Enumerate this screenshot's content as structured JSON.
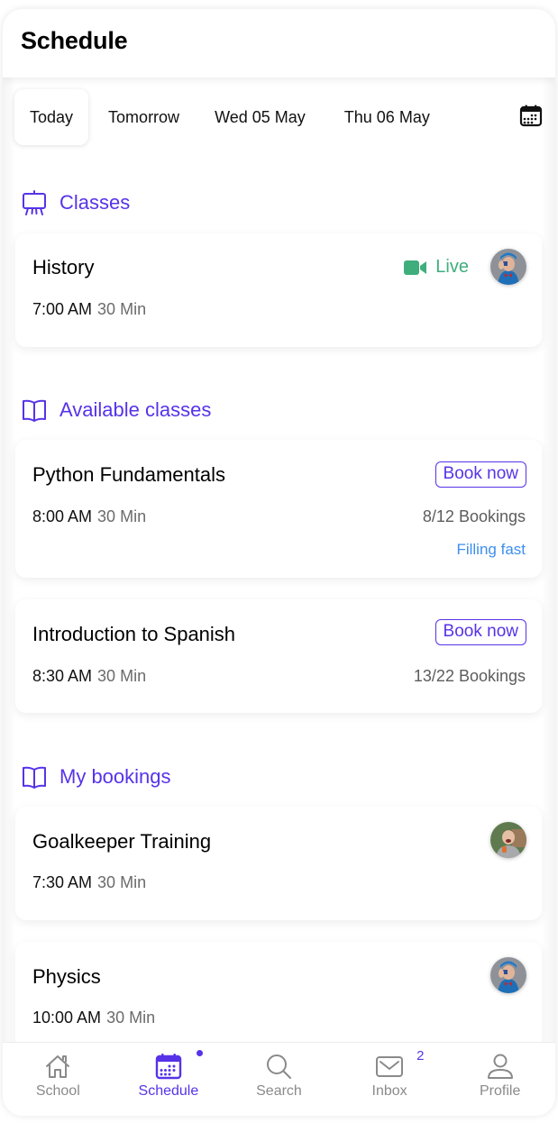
{
  "header": {
    "title": "Schedule"
  },
  "date_tabs": [
    {
      "label": "Today",
      "active": true
    },
    {
      "label": "Tomorrow",
      "active": false
    },
    {
      "label": "Wed 05 May",
      "active": false
    },
    {
      "label": "Thu 06 May",
      "active": false
    }
  ],
  "calendar_button_icon": "calendar-icon",
  "sections": {
    "classes": {
      "title": "Classes",
      "icon": "easel-icon",
      "items": [
        {
          "title": "History",
          "time": "7:00 AM",
          "duration": "30 Min",
          "status": "Live",
          "status_icon": "video-camera-icon",
          "avatar": "teacher-avatar-blue"
        }
      ]
    },
    "available": {
      "title": "Available classes",
      "icon": "book-open-icon",
      "items": [
        {
          "title": "Python Fundamentals",
          "time": "8:00 AM",
          "duration": "30 Min",
          "button": "Book now",
          "bookings": "8/12 Bookings",
          "note": "Filling fast"
        },
        {
          "title": "Introduction to Spanish",
          "time": "8:30 AM",
          "duration": "30 Min",
          "button": "Book now",
          "bookings": "13/22 Bookings"
        }
      ]
    },
    "my_bookings": {
      "title": "My bookings",
      "icon": "book-open-icon",
      "items": [
        {
          "title": "Goalkeeper Training",
          "time": "7:30 AM",
          "duration": "30 Min",
          "avatar": "coach-avatar-child"
        },
        {
          "title": "Physics",
          "time": "10:00 AM",
          "duration": "30 Min",
          "avatar": "teacher-avatar-blue"
        }
      ]
    }
  },
  "tabbar": [
    {
      "label": "School",
      "icon": "home-icon",
      "active": false
    },
    {
      "label": "Schedule",
      "icon": "calendar-icon",
      "active": true,
      "indicator": "dot"
    },
    {
      "label": "Search",
      "icon": "search-icon",
      "active": false
    },
    {
      "label": "Inbox",
      "icon": "mail-icon",
      "active": false,
      "badge": "2"
    },
    {
      "label": "Profile",
      "icon": "user-icon",
      "active": false
    }
  ],
  "colors": {
    "accent": "#5733e8",
    "live": "#3fae7c",
    "filling_fast": "#3d8ef0",
    "muted_text": "#6b6b6b",
    "tab_inactive": "#8a8a8a"
  }
}
